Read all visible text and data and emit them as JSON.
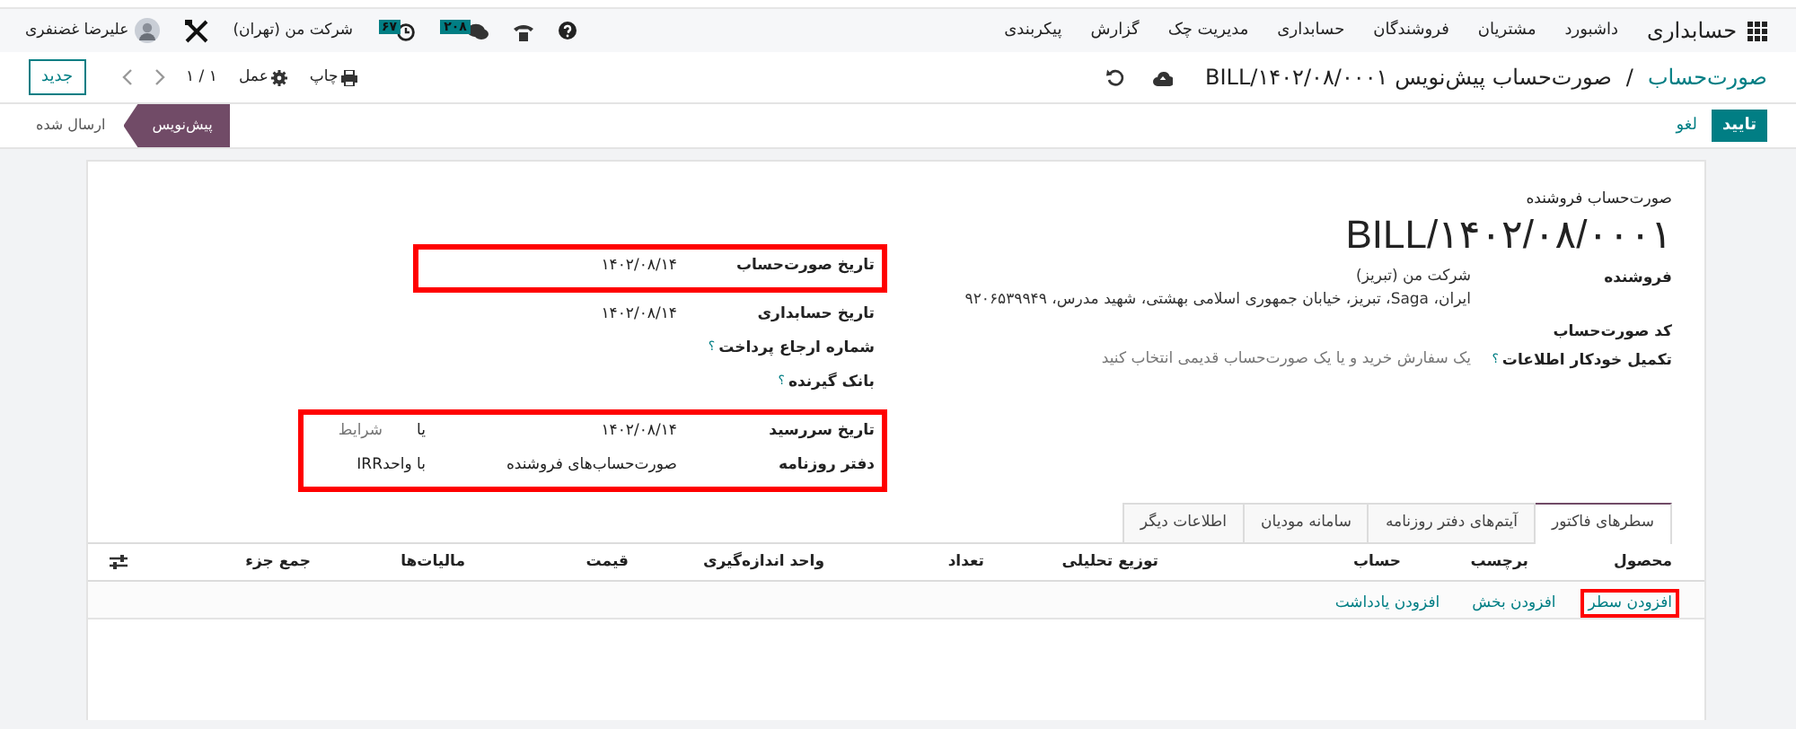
{
  "navbar": {
    "app": "حسابداری",
    "menus": [
      "داشبورد",
      "مشتریان",
      "فروشندگان",
      "حسابداری",
      "مدیریت چک",
      "گزارش",
      "پیکربندی"
    ],
    "systray": {
      "messages_badge": "۲۰۸",
      "activities_badge": "۶۷",
      "company": "شرکت من (تهران)",
      "user": "علیرضا غضنفری"
    }
  },
  "control_panel": {
    "breadcrumb": "صورت‌حساب",
    "separator": "/",
    "title": "صورت‌حساب پیش‌نویس BILL/۱۴۰۲/۰۸/۰۰۰۱",
    "print": "چاپ",
    "action": "عمل",
    "pager": "۱ / ۱",
    "new_button": "جدید"
  },
  "statusbar": {
    "buttons": [
      {
        "label": "تایید",
        "kind": "primary"
      },
      {
        "label": "لغو",
        "kind": "link"
      }
    ],
    "stages": [
      {
        "label": "پیش‌نویس",
        "selected": true
      },
      {
        "label": "ارسال شده",
        "selected": false
      }
    ]
  },
  "sheet": {
    "subtitle": "صورت‌حساب فروشنده",
    "title": "BILL/۱۴۰۲/۰۸/۰۰۰۱",
    "main_fields": [
      {
        "label": "فروشنده",
        "lines": [
          "شرکت من (تبریز)",
          "ایران، Saga، تبریز، خیابان جمهوری اسلامی بهشتی، شهید مدرس، ۹۲۰۶۵۳۹۹۴۹"
        ]
      },
      {
        "label": "کد صورت‌حساب"
      },
      {
        "label": "تکمیل خودکار اطلاعات",
        "help_mark": "؟",
        "placeholder": "یک سفارش خرید و یا یک صورت‌حساب قدیمی انتخاب کنید"
      }
    ],
    "date_groups": [
      {
        "highlighted": true,
        "fields": [
          {
            "label": "تاریخ صورت‌حساب",
            "value": "۱۴۰۲/۰۸/۱۴"
          }
        ]
      },
      {
        "highlighted": false,
        "fields": [
          {
            "label": "تاریخ حسابداری",
            "value": "۱۴۰۲/۰۸/۱۴"
          },
          {
            "label": "شماره ارجاع پرداخت",
            "help_mark": "؟"
          },
          {
            "label": "بانک گیرنده",
            "help_mark": "؟"
          }
        ]
      },
      {
        "highlighted": true,
        "fields": [
          {
            "label": "تاریخ سررسید",
            "value": "۱۴۰۲/۰۸/۱۴",
            "aside_label": "یا",
            "aside_placeholder": "شرایط"
          },
          {
            "label": "دفتر روزنامه",
            "value": "صورت‌حساب‌های فروشنده",
            "aside_label": "با واحد",
            "aside_value": "IRR"
          }
        ]
      }
    ],
    "tabs": [
      {
        "label": "سطرهای فاکتور",
        "selected": true
      },
      {
        "label": "آیتم‌های دفتر روزنامه",
        "selected": false
      },
      {
        "label": "سامانه مودیان",
        "selected": false
      },
      {
        "label": "اطلاعات دیگر",
        "selected": false
      }
    ],
    "table": {
      "columns": [
        "محصول",
        "برچسب",
        "حساب",
        "توزیع تحلیلی",
        "تعداد",
        "واحد اندازه‌گیری",
        "قیمت",
        "مالیات‌ها",
        "جمع جزء"
      ],
      "add_links": [
        {
          "label": "افزودن سطر",
          "highlighted": true
        },
        {
          "label": "افزودن بخش",
          "highlighted": false
        },
        {
          "label": "افزودن یادداشت",
          "highlighted": false
        }
      ]
    }
  }
}
